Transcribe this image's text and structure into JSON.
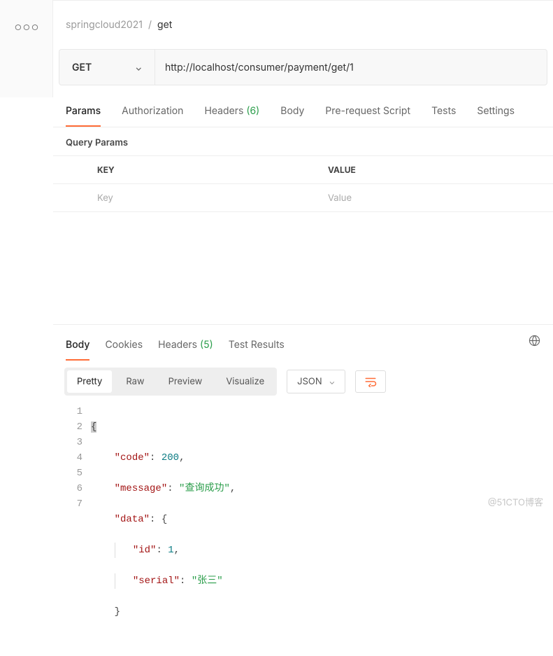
{
  "breadcrumb": {
    "collection": "springcloud2021",
    "sep": "/",
    "current": "get"
  },
  "request": {
    "method": "GET",
    "url": "http://localhost/consumer/payment/get/1",
    "tabs": {
      "params": "Params",
      "auth": "Authorization",
      "headers_label": "Headers",
      "headers_count": "(6)",
      "body": "Body",
      "prereq": "Pre-request Script",
      "tests": "Tests",
      "settings": "Settings"
    }
  },
  "queryParams": {
    "title": "Query Params",
    "headers": {
      "key": "KEY",
      "value": "VALUE"
    },
    "placeholders": {
      "key": "Key",
      "value": "Value"
    }
  },
  "response": {
    "tabs": {
      "body": "Body",
      "cookies": "Cookies",
      "headers_label": "Headers",
      "headers_count": "(5)",
      "testresults": "Test Results"
    },
    "view": {
      "pretty": "Pretty",
      "raw": "Raw",
      "preview": "Preview",
      "visualize": "Visualize"
    },
    "format": "JSON",
    "code_lines": [
      "1",
      "2",
      "3",
      "4",
      "5",
      "6",
      "7"
    ],
    "body_json": {
      "code": 200,
      "message": "查询成功",
      "data": {
        "id": 1,
        "serial": "张三"
      }
    },
    "tokens": {
      "brace_open": "{",
      "brace_close": "}",
      "k_code": "\"code\"",
      "v_code": "200",
      "k_message": "\"message\"",
      "v_message": "\"查询成功\"",
      "k_data": "\"data\"",
      "k_id": "\"id\"",
      "v_id": "1",
      "k_serial": "\"serial\"",
      "v_serial": "\"张三\"",
      "colon": ": ",
      "comma": ","
    }
  },
  "watermark": "@51CTO博客"
}
